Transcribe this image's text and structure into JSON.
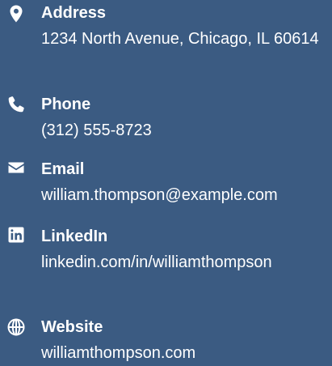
{
  "colors": {
    "background": "#3b5b82",
    "text": "#ffffff"
  },
  "contact": {
    "address": {
      "icon": "map-marker-icon",
      "label": "Address",
      "value": "1234 North Avenue, Chicago, IL 60614"
    },
    "phone": {
      "icon": "phone-icon",
      "label": "Phone",
      "value": "(312) 555-8723"
    },
    "email": {
      "icon": "envelope-icon",
      "label": "Email",
      "value": "william.thompson@example.com"
    },
    "linkedin": {
      "icon": "linkedin-icon",
      "label": "LinkedIn",
      "value": "linkedin.com/in/williamthompson"
    },
    "website": {
      "icon": "globe-icon",
      "label": "Website",
      "value": "williamthompson.com"
    }
  }
}
